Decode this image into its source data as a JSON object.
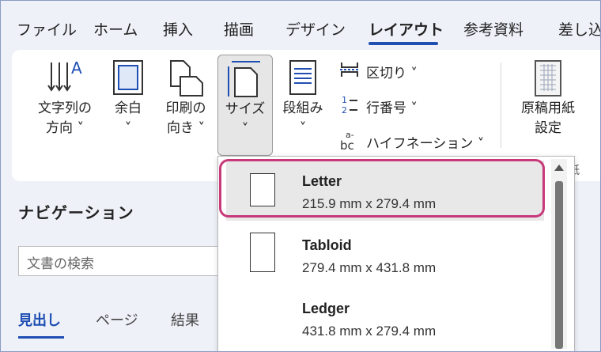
{
  "menu": {
    "tabs": [
      {
        "label": "ファイル"
      },
      {
        "label": "ホーム"
      },
      {
        "label": "挿入"
      },
      {
        "label": "描画"
      },
      {
        "label": "デザイン"
      },
      {
        "label": "レイアウト"
      },
      {
        "label": "参考資料"
      },
      {
        "label": "差し込"
      }
    ],
    "active_tab": "レイアウト"
  },
  "ribbon": {
    "text_direction": {
      "line1": "文字列の",
      "line2": "方向 ˅",
      "icon": "text-direction-icon"
    },
    "margins": {
      "line1": "余白",
      "line2": "˅",
      "icon": "margins-icon"
    },
    "orientation": {
      "line1": "印刷の",
      "line2": "向き ˅",
      "icon": "orientation-icon"
    },
    "size": {
      "line1": "サイズ",
      "line2": "˅",
      "icon": "page-size-icon"
    },
    "columns": {
      "line1": "段組み",
      "line2": "˅",
      "icon": "columns-icon"
    },
    "breaks": {
      "label": "区切り ˅",
      "icon": "breaks-icon"
    },
    "line_numbers": {
      "label": "行番号 ˅",
      "icon": "line-numbers-icon"
    },
    "hyphenation": {
      "label": "ハイフネーション ˅",
      "icon": "hyphenation-icon"
    },
    "manuscript": {
      "line1": "原稿用紙",
      "line2": "設定",
      "icon": "manuscript-paper-icon"
    },
    "group_label_partial": "紙"
  },
  "navigation": {
    "title": "ナビゲーション",
    "search_placeholder": "文書の検索",
    "tabs": [
      {
        "label": "見出し"
      },
      {
        "label": "ページ"
      },
      {
        "label": "結果"
      }
    ],
    "active_tab": "見出し"
  },
  "size_dropdown": {
    "options": [
      {
        "name": "Letter",
        "dims": "215.9 mm x 279.4 mm",
        "selected": true
      },
      {
        "name": "Tabloid",
        "dims": "279.4 mm x 431.8 mm",
        "selected": false
      },
      {
        "name": "Ledger",
        "dims": "431.8 mm x 279.4 mm",
        "selected": false
      }
    ]
  },
  "colors": {
    "accent": "#1f4fb3",
    "highlight": "#c8397a"
  }
}
